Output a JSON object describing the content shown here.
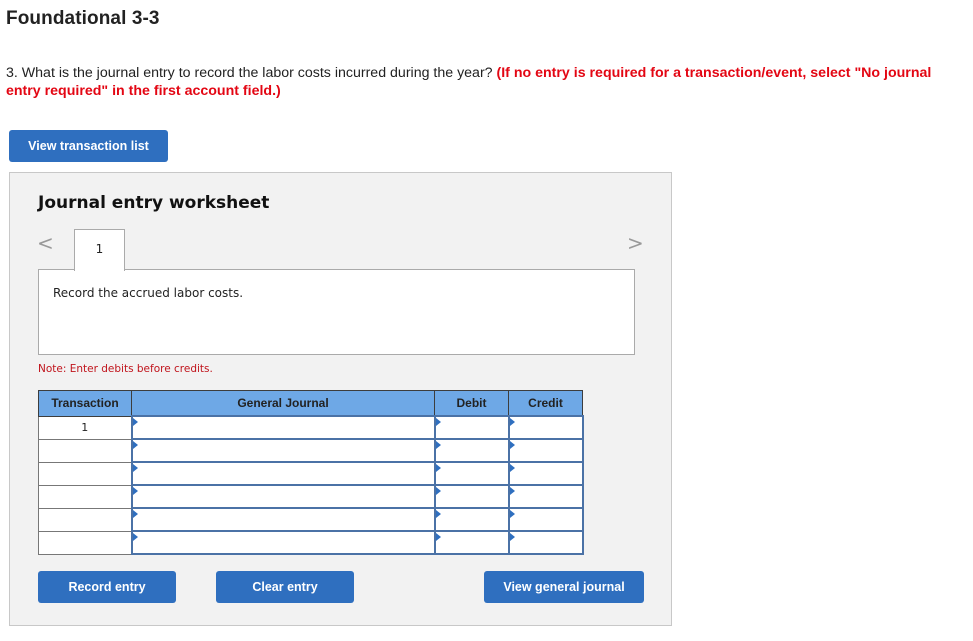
{
  "page": {
    "title": "Foundational 3-3",
    "question_text": "3. What is the journal entry to record the labor costs incurred during the year? ",
    "question_instruction": "(If no entry is required for a transaction/event, select \"No journal entry required\" in the first account field.)"
  },
  "buttons": {
    "view_transaction_list": "View transaction list",
    "record_entry": "Record entry",
    "clear_entry": "Clear entry",
    "view_general_journal": "View general journal"
  },
  "worksheet": {
    "title": "Journal entry worksheet",
    "prev_icon": "chevron-left-icon",
    "next_icon": "chevron-right-icon",
    "prev_glyph": "<",
    "next_glyph": ">",
    "active_tab": "1",
    "description": "Record the accrued labor costs.",
    "note": "Note: Enter debits before credits."
  },
  "table": {
    "headers": [
      "Transaction",
      "General Journal",
      "Debit",
      "Credit"
    ],
    "rows": [
      {
        "transaction": "1",
        "account": "",
        "debit": "",
        "credit": ""
      },
      {
        "transaction": "",
        "account": "",
        "debit": "",
        "credit": ""
      },
      {
        "transaction": "",
        "account": "",
        "debit": "",
        "credit": ""
      },
      {
        "transaction": "",
        "account": "",
        "debit": "",
        "credit": ""
      },
      {
        "transaction": "",
        "account": "",
        "debit": "",
        "credit": ""
      },
      {
        "transaction": "",
        "account": "",
        "debit": "",
        "credit": ""
      }
    ]
  },
  "colors": {
    "button_blue": "#2f6fbf",
    "header_blue": "#6ea8e6",
    "instruction_red": "#e30613",
    "note_red": "#c0141c"
  }
}
